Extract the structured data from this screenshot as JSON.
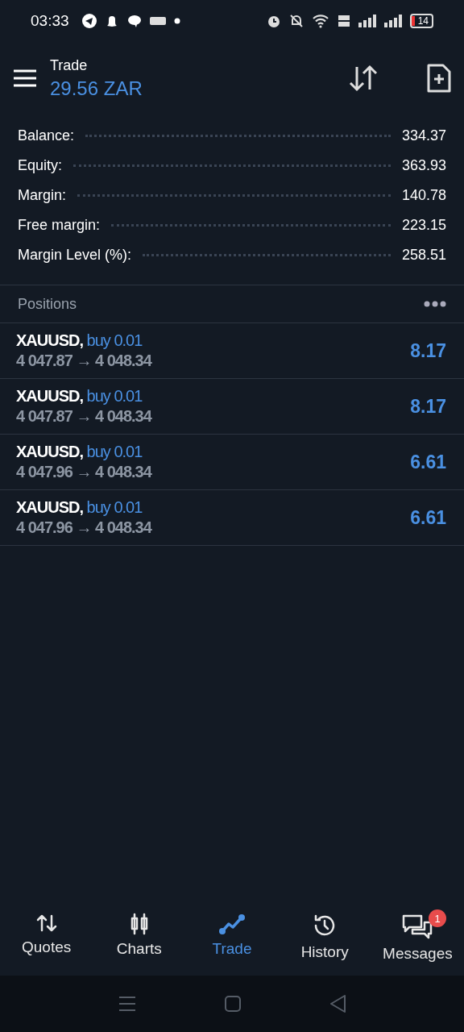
{
  "status_bar": {
    "time": "03:33",
    "battery": "14"
  },
  "header": {
    "title": "Trade",
    "balance": "29.56 ZAR"
  },
  "summary": [
    {
      "label": "Balance:",
      "value": "334.37"
    },
    {
      "label": "Equity:",
      "value": "363.93"
    },
    {
      "label": "Margin:",
      "value": "140.78"
    },
    {
      "label": "Free margin:",
      "value": "223.15"
    },
    {
      "label": "Margin Level (%):",
      "value": "258.51"
    }
  ],
  "positions": {
    "title": "Positions",
    "items": [
      {
        "symbol": "XAUUSD,",
        "side": "buy 0.01",
        "open": "4 047.87",
        "arrow": "→",
        "current": "4 048.34",
        "profit": "8.17"
      },
      {
        "symbol": "XAUUSD,",
        "side": "buy 0.01",
        "open": "4 047.87",
        "arrow": "→",
        "current": "4 048.34",
        "profit": "8.17"
      },
      {
        "symbol": "XAUUSD,",
        "side": "buy 0.01",
        "open": "4 047.96",
        "arrow": "→",
        "current": "4 048.34",
        "profit": "6.61"
      },
      {
        "symbol": "XAUUSD,",
        "side": "buy 0.01",
        "open": "4 047.96",
        "arrow": "→",
        "current": "4 048.34",
        "profit": "6.61"
      }
    ]
  },
  "nav": [
    {
      "kind": "quotes",
      "label": "Quotes",
      "selected": false
    },
    {
      "kind": "charts",
      "label": "Charts",
      "selected": false
    },
    {
      "kind": "trade",
      "label": "Trade",
      "selected": true
    },
    {
      "kind": "history",
      "label": "History",
      "selected": false
    },
    {
      "kind": "messages",
      "label": "Messages",
      "selected": false,
      "badge": "1"
    }
  ]
}
